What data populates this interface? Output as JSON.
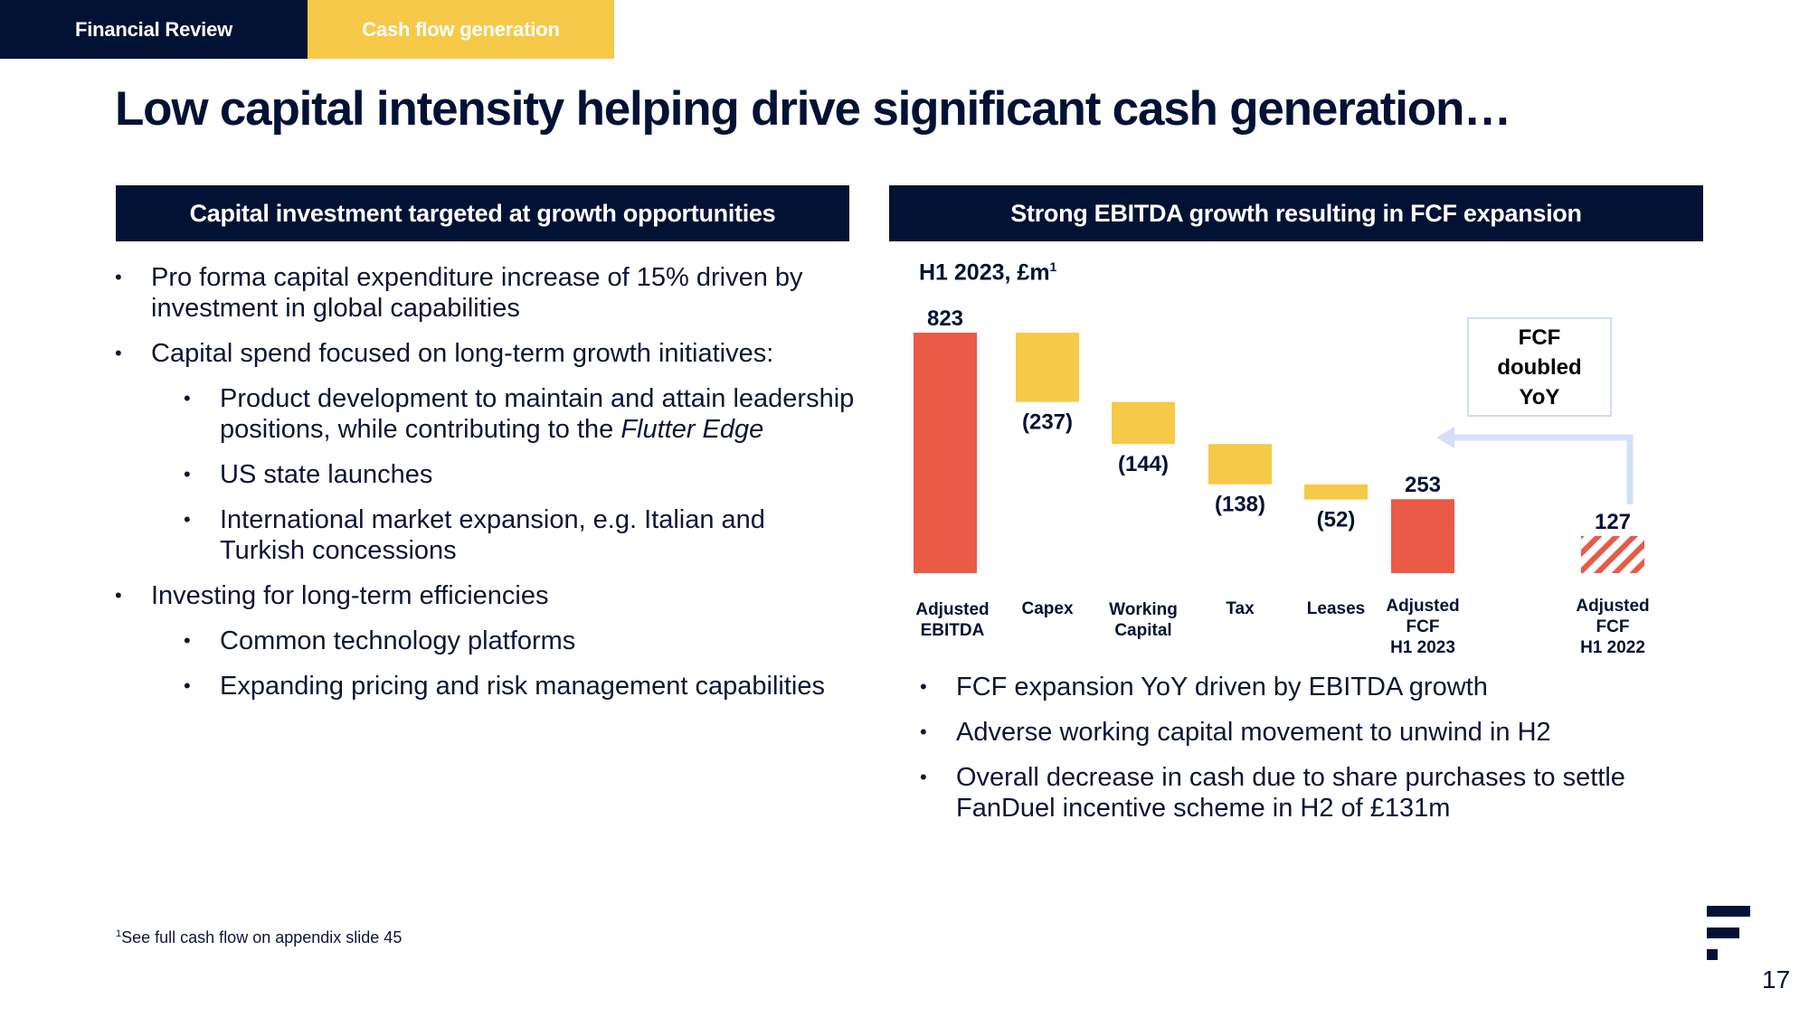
{
  "tabs": [
    {
      "label": "Financial Review",
      "color": "#021235"
    },
    {
      "label": "Cash flow generation",
      "color": "#f7c948"
    }
  ],
  "title": "Low capital intensity helping drive significant cash generation…",
  "left_panel": {
    "header": "Capital investment targeted at growth opportunities",
    "bullets": [
      {
        "text": "Pro forma capital expenditure increase of 15% driven by investment in global capabilities"
      },
      {
        "text": "Capital spend focused on long-term growth initiatives:",
        "sub": [
          {
            "text": "Product development to maintain and attain leadership positions, while contributing to the ",
            "italic": "Flutter Edge"
          },
          {
            "text": "US state launches"
          },
          {
            "text": "International market expansion, e.g. Italian and Turkish concessions"
          }
        ]
      },
      {
        "text": "Investing for long-term efficiencies",
        "sub": [
          {
            "text": "Common technology platforms"
          },
          {
            "text": "Expanding pricing and risk management capabilities"
          }
        ]
      }
    ]
  },
  "right_panel": {
    "header": "Strong EBITDA growth resulting in FCF expansion",
    "chart_subtitle": "H1 2023, £m",
    "chart_subtitle_sup": "1",
    "callout": [
      "FCF",
      "doubled",
      "YoY"
    ],
    "bullets": [
      "FCF expansion YoY driven by EBITDA growth",
      "Adverse working capital movement to unwind in H2",
      "Overall decrease in cash due to share purchases to settle FanDuel incentive scheme in H2 of £131m"
    ]
  },
  "chart_data": {
    "type": "bar",
    "subtype": "waterfall",
    "title": "Strong EBITDA growth resulting in FCF expansion",
    "subtitle": "H1 2023, £m",
    "xlabel": "",
    "ylabel": "",
    "ylim": [
      0,
      823
    ],
    "grid": false,
    "legend": "none",
    "categories": [
      "Adjusted EBITDA",
      "Capex",
      "Working Capital",
      "Tax",
      "Leases",
      "Adjusted FCF H1 2023",
      "Adjusted FCF H1 2022"
    ],
    "category_lines": [
      [
        "Adjusted",
        "EBITDA"
      ],
      [
        "Capex"
      ],
      [
        "Working",
        "Capital"
      ],
      [
        "Tax"
      ],
      [
        "Leases"
      ],
      [
        "Adjusted",
        "FCF",
        "H1 2023"
      ],
      [
        "Adjusted",
        "FCF",
        "H1 2022"
      ]
    ],
    "values": [
      823,
      -237,
      -144,
      -138,
      -52,
      253,
      127
    ],
    "kinds": [
      "total",
      "delta",
      "delta",
      "delta",
      "delta",
      "total",
      "total-hatched"
    ],
    "labels": [
      "823",
      "(237)",
      "(144)",
      "(138)",
      "(52)",
      "253",
      "127"
    ],
    "colors": {
      "total": "#e95a47",
      "delta": "#f7c948",
      "arrow": "#d3e0f7"
    },
    "annotation": "FCF doubled YoY"
  },
  "footnote": {
    "sup": "1",
    "text": "See full cash flow on appendix slide 45"
  },
  "page_number": "17"
}
